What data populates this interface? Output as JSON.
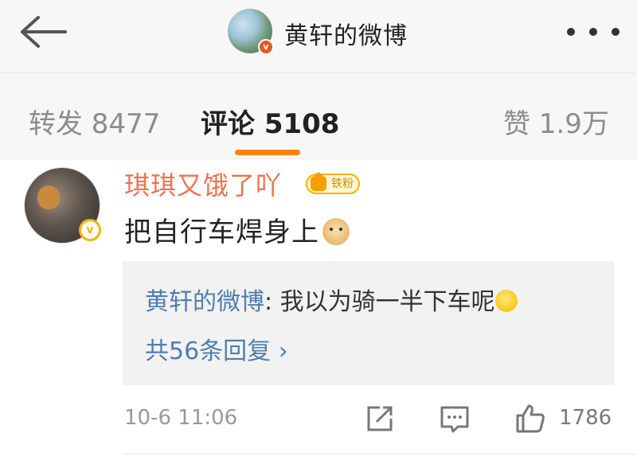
{
  "header": {
    "title": "黄轩的微博",
    "avatar_verified_badge": "v",
    "back_icon": "arrow-left-icon",
    "more_icon": "more-dots-icon"
  },
  "tabs": {
    "repost": "转发 8477",
    "comment": "评论 5108",
    "like": "赞 1.9万",
    "active": "comment",
    "accent_color": "#ff8200"
  },
  "comment": {
    "user_name": "琪琪又饿了吖",
    "fan_badge": "铁粉",
    "verified_badge": "v",
    "text": "把自行车焊身上",
    "text_emoji": "doge-emoji",
    "reply": {
      "author": "黄轩的微博",
      "separator": ":",
      "text": " 我以为骑一半下车呢",
      "emoji": "thinking-emoji",
      "count_label": "共56条回复 ›"
    },
    "time": "10-6 11:06",
    "like_count": "1786",
    "icons": [
      "share-icon",
      "comment-icon",
      "thumbs-up-icon"
    ]
  },
  "colors": {
    "name_color": "#eb7350",
    "link_color": "#507daf",
    "badge_gold": "#f5b400"
  }
}
